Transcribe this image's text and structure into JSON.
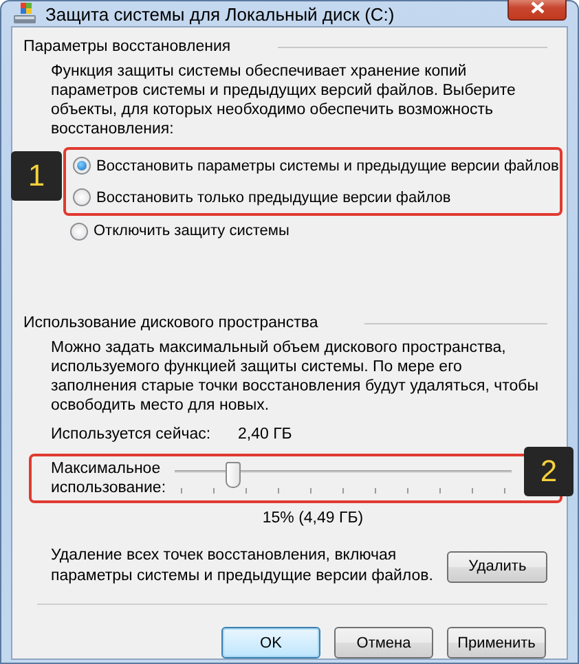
{
  "window": {
    "title": "Защита системы для Локальный диск (C:)"
  },
  "restore_settings": {
    "heading": "Параметры восстановления",
    "description": "Функция защиты системы обеспечивает хранение копий параметров системы и предыдущих версий файлов. Выберите объекты, для которых необходимо обеспечить возможность восстановления:",
    "annotation": "1",
    "options": [
      {
        "label": "Восстановить параметры системы и предыдущие версии файлов",
        "selected": true,
        "highlighted": true
      },
      {
        "label": "Восстановить только предыдущие версии файлов",
        "selected": false,
        "highlighted": true
      },
      {
        "label": "Отключить защиту системы",
        "selected": false,
        "highlighted": false
      }
    ]
  },
  "disk_usage": {
    "heading": "Использование дискового пространства",
    "description": "Можно задать максимальный объем дискового пространства, используемого функцией защиты системы. По мере его заполнения старые точки восстановления будут удаляться, чтобы освободить место для новых.",
    "current_label": "Используется сейчас:",
    "current_value": "2,40 ГБ",
    "max_label": "Максимальное использование:",
    "level": 0.17,
    "annotation": "2",
    "max_value": "15% (4,49 ГБ)",
    "delete_text": "Удаление всех точек восстановления, включая параметры системы и предыдущие версии файлов.",
    "delete_button": "Удалить"
  },
  "buttons": [
    {
      "label": "OK",
      "default": true
    },
    {
      "label": "Отмена",
      "default": false
    },
    {
      "label": "Применить",
      "default": false
    }
  ]
}
